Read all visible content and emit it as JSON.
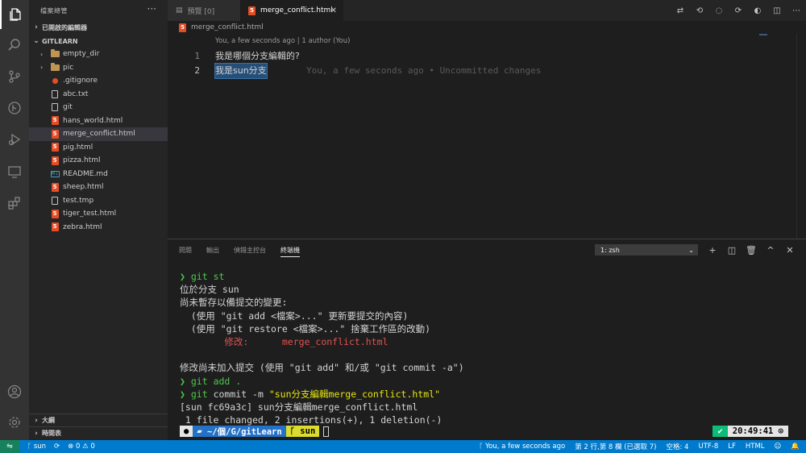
{
  "activity_bar": {
    "icons": [
      "explorer-icon",
      "search-icon",
      "source-control-icon",
      "git-graph-icon",
      "run-debug-icon",
      "remote-explorer-icon",
      "extensions-icon",
      "account-icon",
      "settings-gear-icon"
    ]
  },
  "sidebar": {
    "title": "檔案總管",
    "more": "···",
    "open_editors": "已開啟的編輯器",
    "workspace": "GITLEARN",
    "files": [
      {
        "name": "empty_dir",
        "type": "folder"
      },
      {
        "name": "pic",
        "type": "folder"
      },
      {
        "name": ".gitignore",
        "type": "gitignore"
      },
      {
        "name": "abc.txt",
        "type": "text"
      },
      {
        "name": "git",
        "type": "text"
      },
      {
        "name": "hans_world.html",
        "type": "html"
      },
      {
        "name": "merge_conflict.html",
        "type": "html",
        "selected": true
      },
      {
        "name": "pig.html",
        "type": "html"
      },
      {
        "name": "pizza.html",
        "type": "html"
      },
      {
        "name": "README.md",
        "type": "markdown"
      },
      {
        "name": "sheep.html",
        "type": "html"
      },
      {
        "name": "test.tmp",
        "type": "text"
      },
      {
        "name": "tiger_test.html",
        "type": "html"
      },
      {
        "name": "zebra.html",
        "type": "html"
      }
    ],
    "outline": "大綱",
    "timeline": "時間表"
  },
  "tabs": {
    "preview": "預覽 [0]",
    "active": "merge_conflict.html",
    "close": "✕"
  },
  "breadcrumb": "merge_conflict.html",
  "editor": {
    "codelens": "You, a few seconds ago | 1 author (You)",
    "lines": [
      {
        "number": "1",
        "text": "我是哪個分支編輯的?"
      },
      {
        "number": "2",
        "text": "我是sun分支",
        "blame": "You, a few seconds ago • Uncommitted changes"
      }
    ]
  },
  "panel": {
    "tabs": [
      "問題",
      "輸出",
      "偵錯主控台",
      "終端機"
    ],
    "active_tab": "終端機",
    "terminal_select": "1: zsh"
  },
  "terminal": {
    "prompt": "❯",
    "cmd1": "git st",
    "out1": "位於分支 sun",
    "out2": "尚未暫存以備提交的變更:",
    "out3": "  (使用 \"git add <檔案>...\" 更新要提交的內容)",
    "out4": "  (使用 \"git restore <檔案>...\" 捨棄工作區的改動)",
    "modified_label": "修改:",
    "modified_file": "merge_conflict.html",
    "out5": "修改尚未加入提交 (使用 \"git add\" 和/或 \"git commit -a\")",
    "cmd2": "git add .",
    "cmd3_git": "git",
    "cmd3_rest": " commit -m ",
    "cmd3_msg": "\"sun分支編輯merge_conflict.html\"",
    "out6": "[sun fc69a3c] sun分支編輯merge_conflict.html",
    "out7": " 1 file changed, 2 insertions(+), 1 deletion(-)",
    "path": "~/個/G/gitLearn",
    "branch": "sun",
    "clock_ok": "✔",
    "time": "20:49:41 ⊙"
  },
  "statusbar": {
    "remote": "⇋",
    "branch": "sun",
    "errors": "0",
    "warnings": "0",
    "blame": "You, a few seconds ago",
    "position": "第 2 行,第 8 欄 (已選取 7)",
    "spaces": "空格: 4",
    "encoding": "UTF-8",
    "eol": "LF",
    "language": "HTML"
  }
}
